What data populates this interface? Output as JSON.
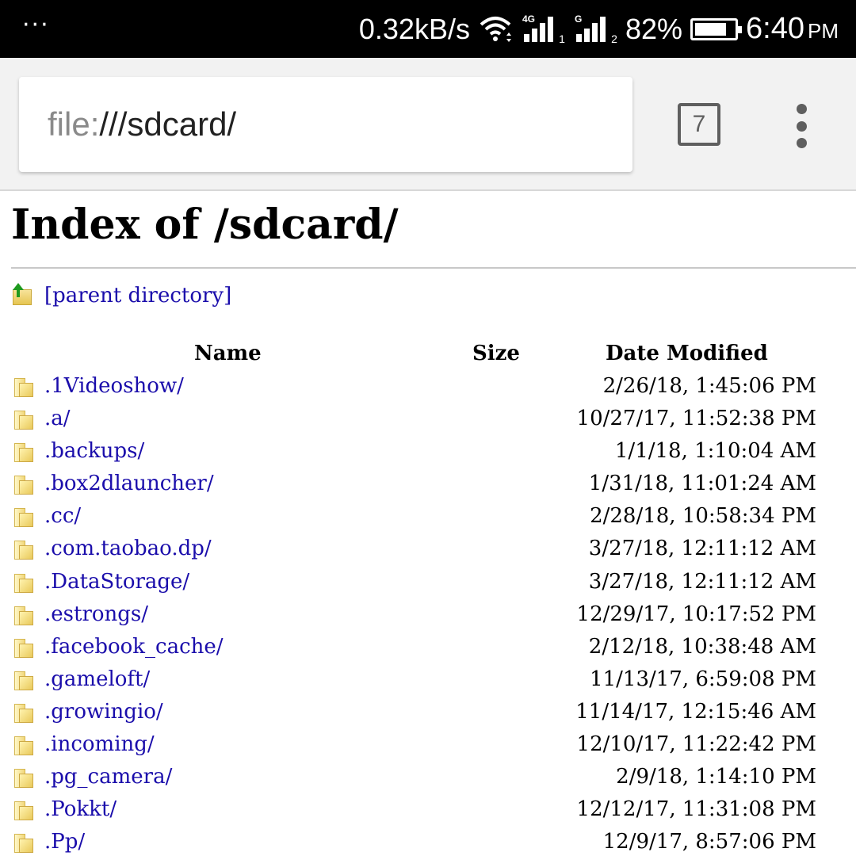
{
  "status_bar": {
    "notif_dots": "···",
    "net_speed": "0.32kB/s",
    "sim1_tag": "4G",
    "sim1_index": "1",
    "sim2_tag": "G",
    "sim2_index": "2",
    "battery_percent": "82%",
    "battery_level": 0.82,
    "time": "6:40",
    "ampm": "PM"
  },
  "browser": {
    "url_scheme": "file:",
    "url_path": "///sdcard/",
    "tab_count": "7"
  },
  "page": {
    "title": "Index of /sdcard/",
    "parent_link": "[parent directory]",
    "columns": {
      "name": "Name",
      "size": "Size",
      "date": "Date Modified"
    },
    "entries": [
      {
        "name": ".1Videoshow/",
        "size": "",
        "date": "2/26/18, 1:45:06 PM"
      },
      {
        "name": ".a/",
        "size": "",
        "date": "10/27/17, 11:52:38 PM"
      },
      {
        "name": ".backups/",
        "size": "",
        "date": "1/1/18, 1:10:04 AM"
      },
      {
        "name": ".box2dlauncher/",
        "size": "",
        "date": "1/31/18, 11:01:24 AM"
      },
      {
        "name": ".cc/",
        "size": "",
        "date": "2/28/18, 10:58:34 PM"
      },
      {
        "name": ".com.taobao.dp/",
        "size": "",
        "date": "3/27/18, 12:11:12 AM"
      },
      {
        "name": ".DataStorage/",
        "size": "",
        "date": "3/27/18, 12:11:12 AM"
      },
      {
        "name": ".estrongs/",
        "size": "",
        "date": "12/29/17, 10:17:52 PM"
      },
      {
        "name": ".facebook_cache/",
        "size": "",
        "date": "2/12/18, 10:38:48 AM"
      },
      {
        "name": ".gameloft/",
        "size": "",
        "date": "11/13/17, 6:59:08 PM"
      },
      {
        "name": ".growingio/",
        "size": "",
        "date": "11/14/17, 12:15:46 AM"
      },
      {
        "name": ".incoming/",
        "size": "",
        "date": "12/10/17, 11:22:42 PM"
      },
      {
        "name": ".pg_camera/",
        "size": "",
        "date": "2/9/18, 1:14:10 PM"
      },
      {
        "name": ".Pokkt/",
        "size": "",
        "date": "12/12/17, 11:31:08 PM"
      },
      {
        "name": ".Pp/",
        "size": "",
        "date": "12/9/17, 8:57:06 PM"
      }
    ]
  }
}
